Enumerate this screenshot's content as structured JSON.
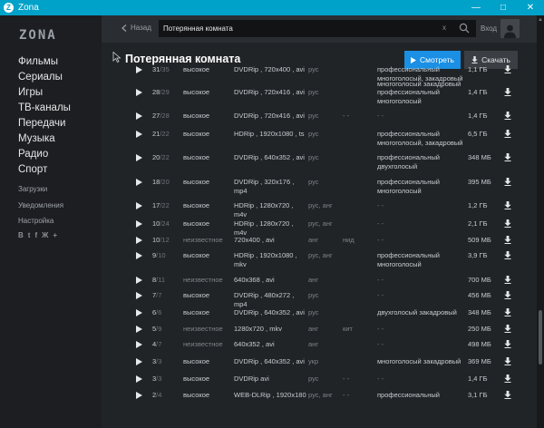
{
  "window": {
    "title": "Zona",
    "icon_letter": "Z"
  },
  "sidebar": {
    "logo": "ZONA",
    "nav": [
      "Фильмы",
      "Сериалы",
      "Игры",
      "ТВ-каналы",
      "Передачи",
      "Музыка",
      "Радио",
      "Спорт"
    ],
    "subnav": [
      "Загрузки",
      "Уведомления",
      "Настройка"
    ],
    "social": [
      "В",
      "t",
      "f",
      "Ж",
      "+"
    ]
  },
  "header": {
    "back_label": "Назад",
    "search_value": "Потерянная комната",
    "clear_label": "x",
    "login_label": "Вход"
  },
  "main": {
    "title": "Потерянная комната",
    "watch_label": "Смотреть",
    "download_label": "Скачать",
    "partial_voice": "многоголосый закадровый"
  },
  "torrents": [
    {
      "seeds": "31",
      "peers": "/35",
      "quality": "высокое",
      "format": "DVDRip , 720x400 , avi",
      "audio": "рус",
      "subs": "",
      "voice": "профессиональный многоголосый, закадровый",
      "size": "1,1 ГБ"
    },
    {
      "seeds": "28",
      "peers": "/29",
      "quality": "высокое",
      "format": "DVDRip , 720x416 , avi",
      "audio": "рус",
      "subs": "",
      "voice": "профессиональный многоголосый",
      "size": "1,4 ГБ"
    },
    {
      "seeds": "27",
      "peers": "/28",
      "quality": "высокое",
      "format": "DVDRip , 720x416 , avi",
      "audio": "рус",
      "subs": "- -",
      "voice": "- -",
      "size": "1,4 ГБ"
    },
    {
      "seeds": "21",
      "peers": "/22",
      "quality": "высокое",
      "format": "HDRip , 1920x1080 , ts",
      "audio": "рус",
      "subs": "",
      "voice": "профессиональный многоголосый, закадровый",
      "size": "6,5 ГБ"
    },
    {
      "seeds": "20",
      "peers": "/22",
      "quality": "высокое",
      "format": "DVDRip , 640x352 , avi",
      "audio": "рус",
      "subs": "",
      "voice": "профессиональный двухголосый",
      "size": "348 МБ"
    },
    {
      "seeds": "18",
      "peers": "/20",
      "quality": "высокое",
      "format": "DVDRip , 320x176 , mp4",
      "audio": "рус",
      "subs": "",
      "voice": "профессиональный многоголосый",
      "size": "395 МБ"
    },
    {
      "seeds": "17",
      "peers": "/22",
      "quality": "высокое",
      "format": "HDRip , 1280x720 , m4v",
      "audio": "рус, анг",
      "subs": "",
      "voice": "- -",
      "size": "1,2 ГБ"
    },
    {
      "seeds": "10",
      "peers": "/24",
      "quality": "высокое",
      "format": "HDRip , 1280x720 , m4v",
      "audio": "рус, анг",
      "subs": "",
      "voice": "- -",
      "size": "2,1 ГБ"
    },
    {
      "seeds": "10",
      "peers": "/12",
      "quality": "неизвестное",
      "format": "720x400 , avi",
      "audio": "анг",
      "subs": "нид",
      "voice": "- -",
      "size": "509 МБ"
    },
    {
      "seeds": "9",
      "peers": "/10",
      "quality": "высокое",
      "format": "HDRip , 1920x1080 , mkv",
      "audio": "рус, анг",
      "subs": "",
      "voice": "профессиональный многоголосый",
      "size": "3,9 ГБ"
    },
    {
      "seeds": "8",
      "peers": "/11",
      "quality": "неизвестное",
      "format": "640x368 , avi",
      "audio": "анг",
      "subs": "",
      "voice": "- -",
      "size": "700 МБ"
    },
    {
      "seeds": "7",
      "peers": "/7",
      "quality": "высокое",
      "format": "DVDRip , 480x272 , mp4",
      "audio": "рус",
      "subs": "",
      "voice": "- -",
      "size": "456 МБ"
    },
    {
      "seeds": "6",
      "peers": "/6",
      "quality": "высокое",
      "format": "DVDRip , 640x352 , avi",
      "audio": "рус",
      "subs": "",
      "voice": "двухголосый закадровый",
      "size": "348 МБ"
    },
    {
      "seeds": "5",
      "peers": "/9",
      "quality": "неизвестное",
      "format": "1280x720 , mkv",
      "audio": "анг",
      "subs": "кит",
      "voice": "- -",
      "size": "250 МБ"
    },
    {
      "seeds": "4",
      "peers": "/7",
      "quality": "неизвестное",
      "format": "640x352 , avi",
      "audio": "анг",
      "subs": "",
      "voice": "- -",
      "size": "498 МБ"
    },
    {
      "seeds": "3",
      "peers": "/3",
      "quality": "высокое",
      "format": "DVDRip , 640x352 , avi",
      "audio": "укр",
      "subs": "",
      "voice": "многоголосый закадровый",
      "size": "369 МБ"
    },
    {
      "seeds": "3",
      "peers": "/3",
      "quality": "высокое",
      "format": "DVDRip avi",
      "audio": "рус",
      "subs": "- -",
      "voice": "- -",
      "size": "1,4 ГБ"
    },
    {
      "seeds": "2",
      "peers": "/4",
      "quality": "высокое",
      "format": "WEB-DLRip , 1920x180",
      "audio": "рус, анг",
      "subs": "- -",
      "voice": "профессиональный",
      "size": "3,1 ГБ"
    }
  ],
  "colors": {
    "accent": "#1a8fe3",
    "titlebar": "#00a2c9",
    "background": "#212427"
  }
}
